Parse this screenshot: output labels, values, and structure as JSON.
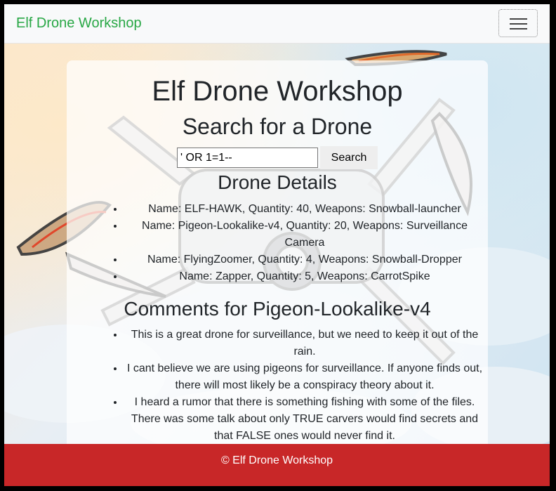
{
  "navbar": {
    "brand": "Elf Drone Workshop",
    "toggler_icon": "hamburger-icon"
  },
  "main": {
    "title": "Elf Drone Workshop",
    "search_heading": "Search for a Drone",
    "search_value": "' OR 1=1--",
    "search_button": "Search",
    "details_heading": "Drone Details",
    "drones": [
      "Name: ELF-HAWK, Quantity: 40, Weapons: Snowball-launcher",
      "Name: Pigeon-Lookalike-v4, Quantity: 20, Weapons: Surveillance Camera",
      "Name: FlyingZoomer, Quantity: 4, Weapons: Snowball-Dropper",
      "Name: Zapper, Quantity: 5, Weapons: CarrotSpike"
    ],
    "comments_heading": "Comments for Pigeon-Lookalike-v4",
    "comments": [
      "This is a great drone for surveillance, but we need to keep it out of the rain.",
      "I cant believe we are using pigeons for surveillance. If anyone finds out, there will most likely be a conspiracy theory about it.",
      "I heard a rumor that there is something fishing with some of the files. There was some talk about only TRUE carvers would find secrets and that FALSE ones would never find it."
    ]
  },
  "footer": {
    "text": "© Elf Drone Workshop"
  },
  "colors": {
    "brand": "#28a745",
    "footer_bg": "#c82728",
    "navbar_bg": "#f8f9fa"
  }
}
